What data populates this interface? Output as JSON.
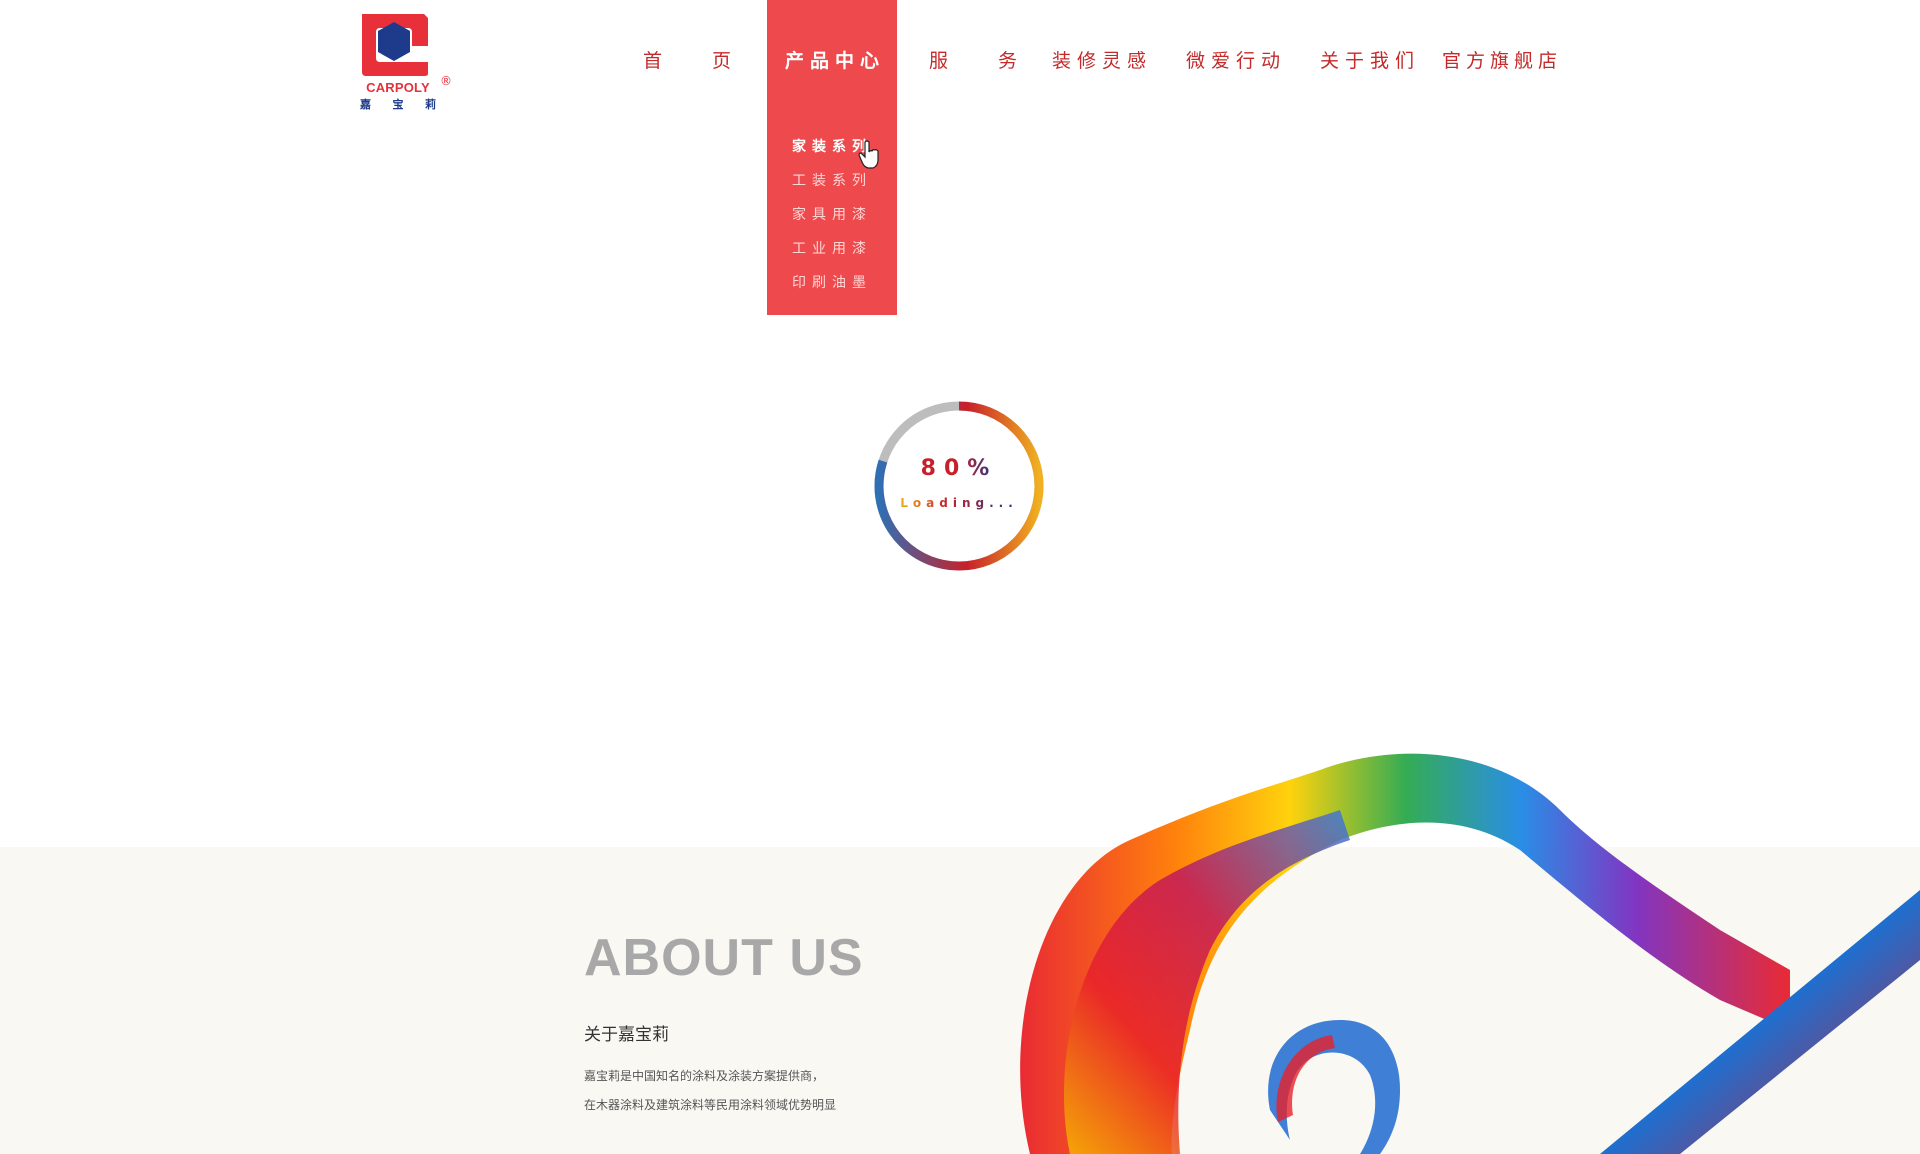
{
  "brand": {
    "name_en": "CARPOLY",
    "name_cn_chars": [
      "嘉",
      "宝",
      "莉"
    ],
    "reg_mark": "®",
    "primary_color": "#e8303a",
    "secondary_color": "#1e3a8a"
  },
  "nav": {
    "items": [
      {
        "label": "首 页",
        "active": false
      },
      {
        "label": "产品中心",
        "active": true
      },
      {
        "label": "服 务",
        "active": false
      },
      {
        "label": "装修灵感",
        "active": false
      },
      {
        "label": "微爱行动",
        "active": false
      },
      {
        "label": "关于我们",
        "active": false
      },
      {
        "label": "官方旗舰店",
        "active": false
      }
    ],
    "active_color": "#ee4a4d"
  },
  "dropdown": {
    "items": [
      "家装系列",
      "工装系列",
      "家具用漆",
      "工业用漆",
      "印刷油墨"
    ],
    "hovered_index": 0
  },
  "loader": {
    "percent_text": "80%",
    "progress": 0.8,
    "status_text": "Loading..."
  },
  "about": {
    "title": "ABOUT US",
    "subtitle": "关于嘉宝莉",
    "lines": [
      "嘉宝莉是中国知名的涂料及涂装方案提供商，",
      "在木器涂料及建筑涂料等民用涂料领域优势明显"
    ]
  }
}
